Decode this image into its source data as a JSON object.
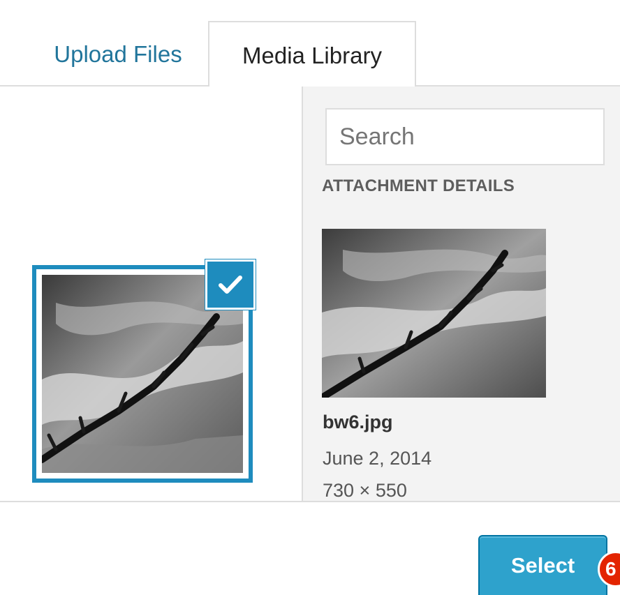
{
  "tabs": [
    {
      "label": "Upload Files",
      "active": false
    },
    {
      "label": "Media Library",
      "active": true
    }
  ],
  "search": {
    "placeholder": "Search"
  },
  "attachment_details": {
    "title": "ATTACHMENT DETAILS",
    "filename": "bw6.jpg",
    "date": "June 2, 2014",
    "dimensions": "730 × 550"
  },
  "select_button": {
    "label": "Select"
  },
  "step_badge": {
    "label": "6"
  },
  "icons": {
    "selected_check": "checkmark-icon"
  },
  "colors": {
    "accent": "#1e8cbe",
    "button": "#2ea2cc",
    "badge": "#e32400",
    "link": "#21759b"
  }
}
